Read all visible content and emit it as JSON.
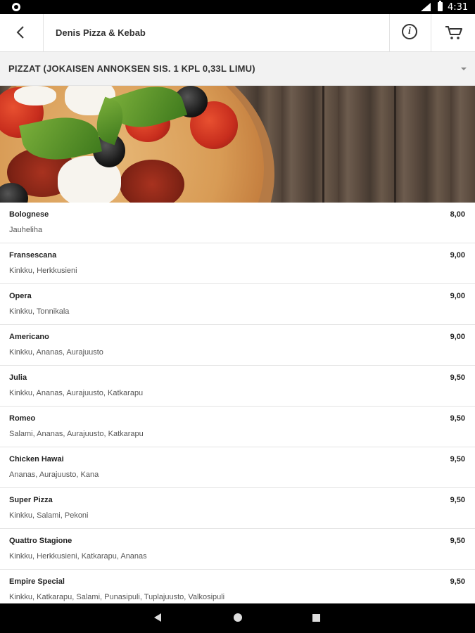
{
  "status": {
    "time": "4:31"
  },
  "appbar": {
    "title": "Denis Pizza & Kebab"
  },
  "category": {
    "label": "PIZZAT (JOKAISEN ANNOKSEN SIS. 1 KPL 0,33L LIMU)"
  },
  "items": [
    {
      "name": "Bolognese",
      "desc": "Jauheliha",
      "price": "8,00"
    },
    {
      "name": "Fransescana",
      "desc": "Kinkku, Herkkusieni",
      "price": "9,00"
    },
    {
      "name": "Opera",
      "desc": "Kinkku, Tonnikala",
      "price": "9,00"
    },
    {
      "name": "Americano",
      "desc": "Kinkku, Ananas, Aurajuusto",
      "price": "9,00"
    },
    {
      "name": "Julia",
      "desc": "Kinkku, Ananas, Aurajuusto, Katkarapu",
      "price": "9,50"
    },
    {
      "name": "Romeo",
      "desc": "Salami, Ananas, Aurajuusto, Katkarapu",
      "price": "9,50"
    },
    {
      "name": "Chicken Hawai",
      "desc": "Ananas, Aurajuusto, Kana",
      "price": "9,50"
    },
    {
      "name": "Super Pizza",
      "desc": "Kinkku, Salami, Pekoni",
      "price": "9,50"
    },
    {
      "name": "Quattro Stagione",
      "desc": "Kinkku, Herkkusieni, Katkarapu, Ananas",
      "price": "9,50"
    },
    {
      "name": "Empire Special",
      "desc": "Kinkku, Katkarapu, Salami, Punasipuli, Tuplajuusto, Valkosipuli",
      "price": "9,50"
    }
  ]
}
